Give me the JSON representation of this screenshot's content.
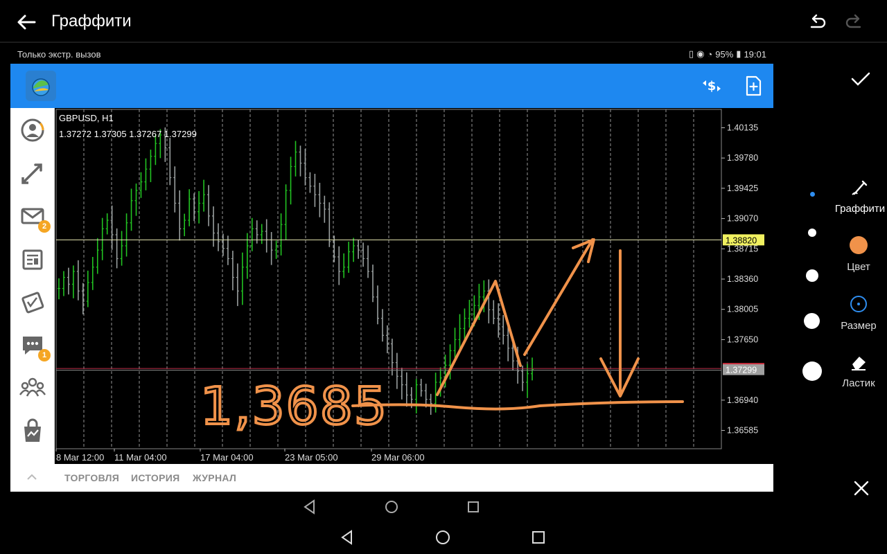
{
  "graffiti": {
    "title": "Граффити",
    "tools": {
      "graffiti": "Граффити",
      "color": "Цвет",
      "size": "Размер",
      "eraser": "Ластик"
    },
    "selected_color": "#f0924a"
  },
  "status_bar": {
    "carrier": "Только экстр. вызов",
    "battery": "95%",
    "time": "19:01"
  },
  "sidebar": {
    "mail_badge": "2",
    "chat_badge": "1"
  },
  "bottom_tabs": [
    "ТОРГОВЛЯ",
    "ИСТОРИЯ",
    "ЖУРНАЛ"
  ],
  "chart_data": {
    "type": "bar",
    "symbol": "GBPUSD, H1",
    "ohlc": "1.37272 1.37305 1.37267 1.37299",
    "y_ticks": [
      "1.40135",
      "1.39780",
      "1.39425",
      "1.39070",
      "1.38715",
      "1.38360",
      "1.38005",
      "1.37650",
      "1.37299",
      "1.36940",
      "1.36585"
    ],
    "x_labels": [
      "8 Mar 12:00",
      "11 Mar 04:00",
      "17 Mar 04:00",
      "23 Mar 05:00",
      "29 Mar 06:00"
    ],
    "ylim": [
      1.3637,
      1.4035
    ],
    "current_price": 1.37299,
    "current_price_label": "1.37299",
    "hline_price": 1.3882,
    "hline_label": "1.38820",
    "annotation": "1,3685",
    "series_close": [
      1.3825,
      1.3838,
      1.383,
      1.3845,
      1.3822,
      1.381,
      1.3832,
      1.385,
      1.387,
      1.3895,
      1.3905,
      1.3888,
      1.386,
      1.3875,
      1.3902,
      1.3928,
      1.394,
      1.395,
      1.3965,
      1.398,
      1.3995,
      1.4005,
      1.399,
      1.3955,
      1.3925,
      1.3895,
      1.3905,
      1.393,
      1.3915,
      1.3925,
      1.3935,
      1.391,
      1.389,
      1.388,
      1.3872,
      1.386,
      1.3838,
      1.3822,
      1.385,
      1.3875,
      1.3895,
      1.3888,
      1.3892,
      1.3882,
      1.387,
      1.3875,
      1.39,
      1.394,
      1.3968,
      1.3985,
      1.3972,
      1.3955,
      1.3945,
      1.3935,
      1.3925,
      1.3918,
      1.388,
      1.3862,
      1.3845,
      1.385,
      1.3868,
      1.3875,
      1.387,
      1.386,
      1.3845,
      1.3815,
      1.379,
      1.377,
      1.376,
      1.3738,
      1.3722,
      1.3712,
      1.37,
      1.3695,
      1.3712,
      1.3705,
      1.3695,
      1.369,
      1.3715,
      1.372,
      1.3735,
      1.3752,
      1.3765,
      1.3778,
      1.379,
      1.3795,
      1.3805,
      1.3815,
      1.3822,
      1.38,
      1.379,
      1.378,
      1.377,
      1.3755,
      1.374,
      1.3728,
      1.3715,
      1.3725,
      1.373
    ]
  }
}
